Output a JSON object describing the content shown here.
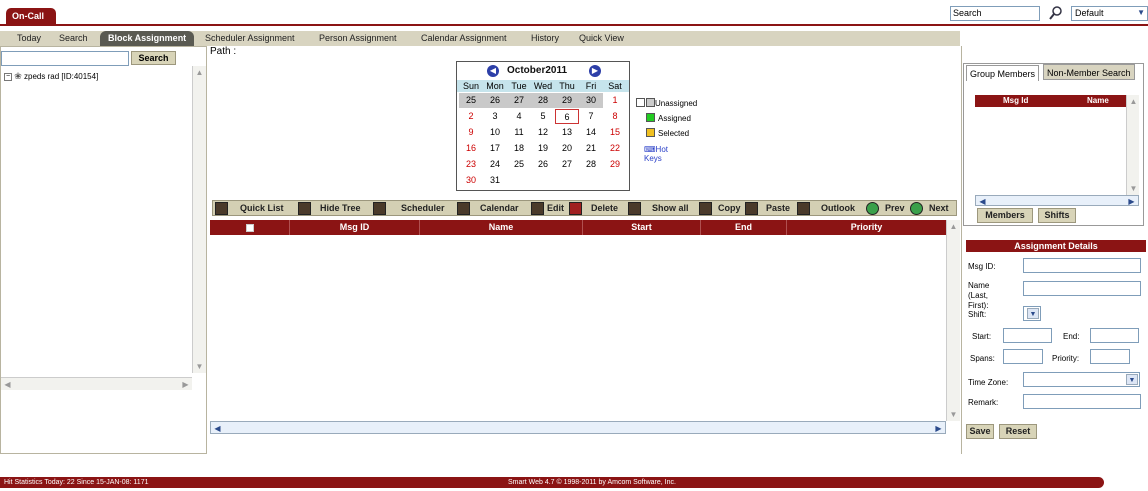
{
  "app": {
    "tab_label": "On-Call"
  },
  "top_search": {
    "value": "Search",
    "default_value": "Default"
  },
  "nav": {
    "items": [
      "Today",
      "Search",
      "Block Assignment",
      "Scheduler Assignment",
      "Person Assignment",
      "Calendar Assignment",
      "History",
      "Quick View"
    ],
    "active": "Block Assignment"
  },
  "left": {
    "search_button": "Search",
    "tree_node": "zpeds rad [ID:40154]"
  },
  "path_label": "Path :",
  "calendar": {
    "title": "October2011",
    "weekdays": [
      "Sun",
      "Mon",
      "Tue",
      "Wed",
      "Thu",
      "Fri",
      "Sat"
    ],
    "weeks": [
      [
        "25",
        "26",
        "27",
        "28",
        "29",
        "30",
        "1"
      ],
      [
        "2",
        "3",
        "4",
        "5",
        "6",
        "7",
        "8"
      ],
      [
        "9",
        "10",
        "11",
        "12",
        "13",
        "14",
        "15"
      ],
      [
        "16",
        "17",
        "18",
        "19",
        "20",
        "21",
        "22"
      ],
      [
        "23",
        "24",
        "25",
        "26",
        "27",
        "28",
        "29"
      ],
      [
        "30",
        "31",
        "",
        "",
        "",
        "",
        ""
      ]
    ]
  },
  "legend": {
    "unassigned": "Unassigned",
    "assigned": "Assigned",
    "selected": "Selected",
    "hot_keys": "Hot Keys"
  },
  "toolbar": {
    "quick_list": "Quick List",
    "hide_tree": "Hide Tree",
    "scheduler": "Scheduler",
    "calendar": "Calendar",
    "edit": "Edit",
    "delete": "Delete",
    "show_all": "Show all",
    "copy": "Copy",
    "paste": "Paste",
    "outlook": "Outlook",
    "prev": "Prev",
    "next": "Next"
  },
  "grid": {
    "columns": [
      "Msg ID",
      "Name",
      "Start",
      "End",
      "Priority"
    ]
  },
  "right": {
    "tabs": [
      "Group Members",
      "Non-Member Search"
    ],
    "members_columns": [
      "Msg Id",
      "Name"
    ],
    "members_button": "Members",
    "shifts_button": "Shifts",
    "assignment_details_title": "Assignment Details",
    "labels": {
      "msg_id": "Msg ID:",
      "name": "Name (Last, First):",
      "shift": "Shift:",
      "start": "Start:",
      "end": "End:",
      "spans": "Spans:",
      "priority": "Priority:",
      "time_zone": "Time Zone:",
      "remark": "Remark:"
    },
    "save_button": "Save",
    "reset_button": "Reset"
  },
  "footer": {
    "hits": "Hit Statistics Today: 22 Since 15-JAN-08: 1171",
    "copyright": "Smart Web 4.7 © 1998-2011 by Amcom Software, Inc."
  },
  "colors": {
    "brand": "#8b1414",
    "toolbar_bg": "#d4d0b4",
    "calendar_dow_bg": "#c6e4ec",
    "assigned": "#22cc22",
    "selected": "#f0c020"
  }
}
